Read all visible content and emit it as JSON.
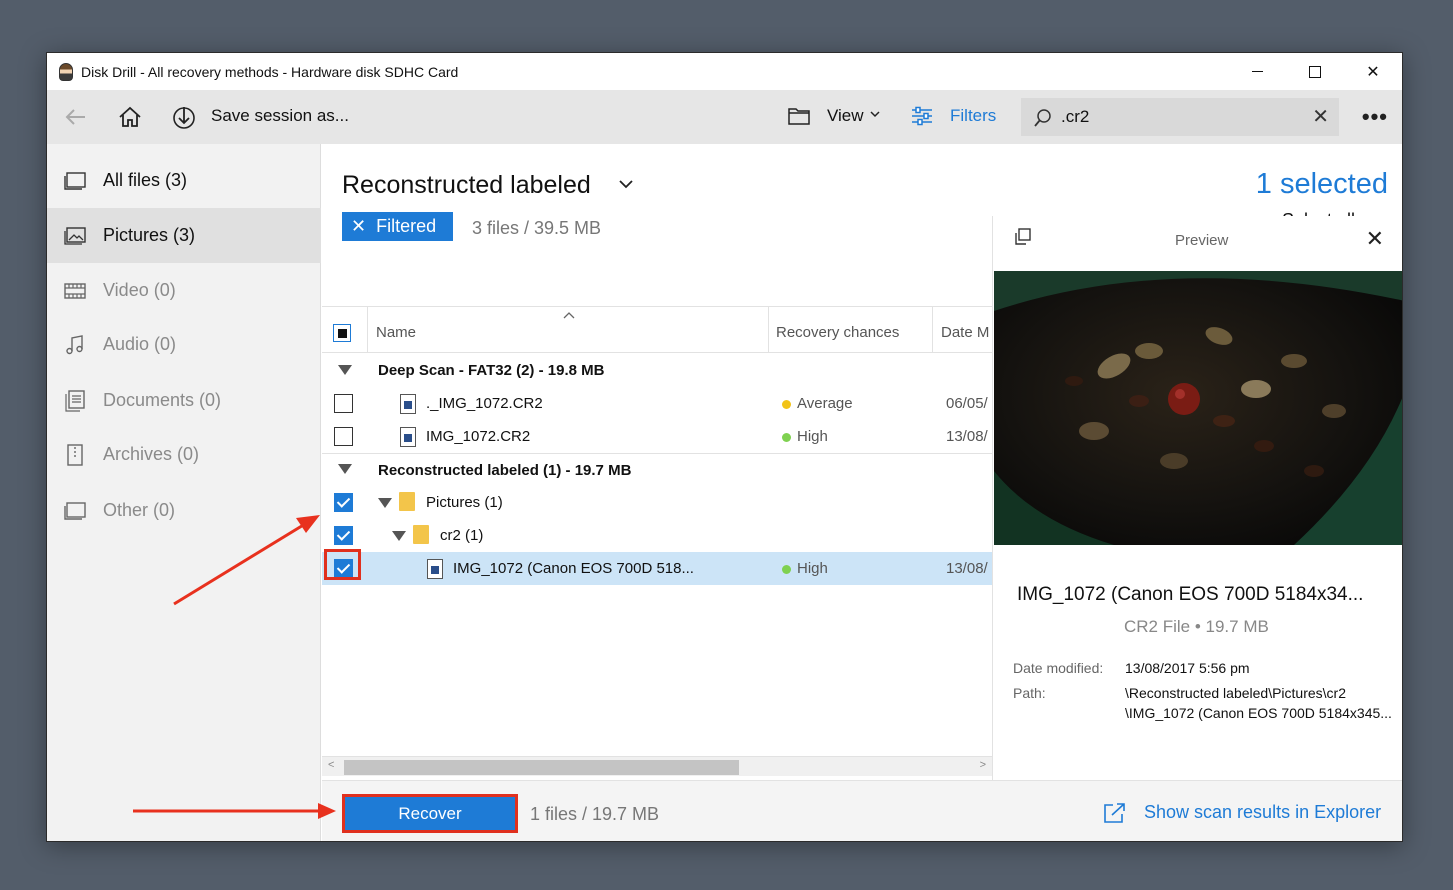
{
  "window": {
    "title": "Disk Drill - All recovery methods - Hardware disk SDHC Card"
  },
  "toolbar": {
    "save_session": "Save session as...",
    "view": "View",
    "filters": "Filters",
    "search_value": ".cr2"
  },
  "sidebar": {
    "items": [
      {
        "label": "All files (3)"
      },
      {
        "label": "Pictures (3)"
      },
      {
        "label": "Video (0)"
      },
      {
        "label": "Audio (0)"
      },
      {
        "label": "Documents (0)"
      },
      {
        "label": "Archives (0)"
      },
      {
        "label": "Other (0)"
      }
    ]
  },
  "main": {
    "title": "Reconstructed labeled",
    "filtered_badge": "Filtered",
    "summary": "3 files / 39.5 MB",
    "selected_count": "1 selected",
    "select_all": "Select all"
  },
  "table": {
    "columns": {
      "name": "Name",
      "recovery": "Recovery chances",
      "date": "Date M"
    },
    "groups": [
      {
        "label": "Deep Scan - FAT32 (2) - 19.8 MB",
        "rows": [
          {
            "name": "._IMG_1072.CR2",
            "recovery": "Average",
            "date": "06/05/"
          },
          {
            "name": "IMG_1072.CR2",
            "recovery": "High",
            "date": "13/08/"
          }
        ]
      },
      {
        "label": "Reconstructed labeled (1) - 19.7 MB",
        "folder1": "Pictures (1)",
        "folder2": "cr2 (1)",
        "rows": [
          {
            "name": "IMG_1072 (Canon EOS 700D 518...",
            "recovery": "High",
            "date": "13/08/"
          }
        ]
      }
    ]
  },
  "preview": {
    "title": "Preview",
    "filename": "IMG_1072 (Canon EOS 700D 5184x34...",
    "meta": "CR2 File • 19.7 MB",
    "date_label": "Date modified:",
    "date_value": "13/08/2017 5:56 pm",
    "path_label": "Path:",
    "path_line1": "\\Reconstructed labeled\\Pictures\\cr2",
    "path_line2": "\\IMG_1072 (Canon EOS 700D 5184x345..."
  },
  "bottom": {
    "recover": "Recover",
    "info": "1 files / 19.7 MB",
    "explorer": "Show scan results in Explorer"
  },
  "colors": {
    "accent": "#1e7bd6",
    "highlight": "#e0301e",
    "average": "#f2c318",
    "high": "#7fd150",
    "selected_row": "#cce4f7"
  },
  "icons": [
    "back-arrow-icon",
    "home-icon",
    "download-icon",
    "folder-icon",
    "filters-icon",
    "search-icon",
    "more-icon",
    "copy-icon",
    "external-link-icon"
  ]
}
